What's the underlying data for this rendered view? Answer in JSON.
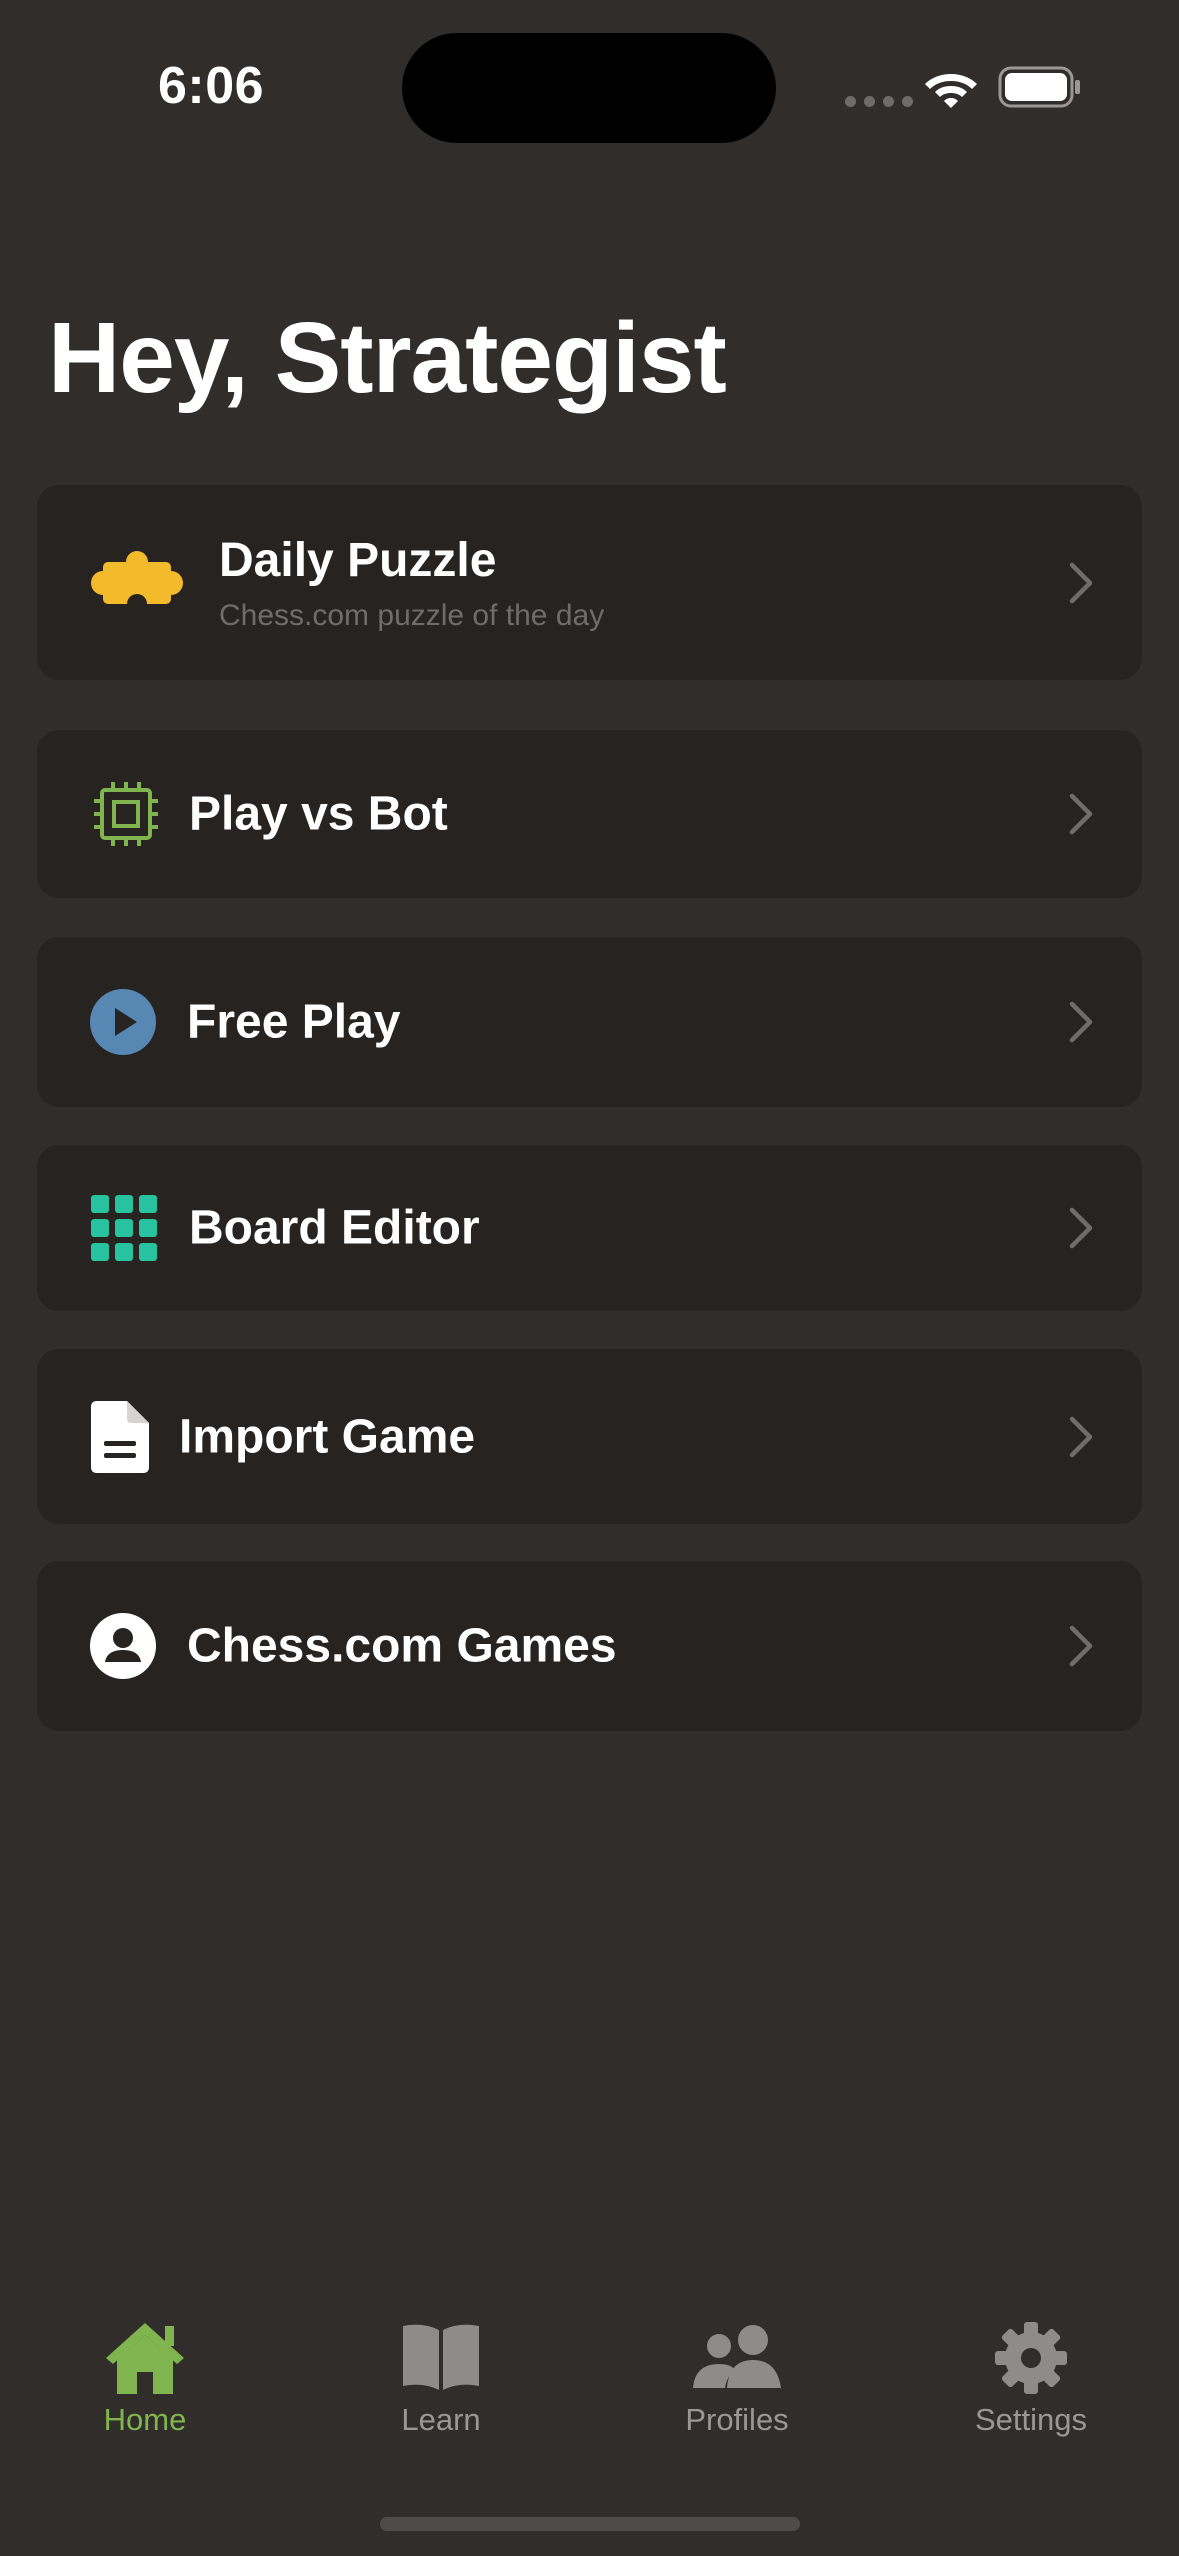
{
  "status_bar": {
    "time": "6:06"
  },
  "header": {
    "title": "Hey, Strategist"
  },
  "menu": [
    {
      "label": "Daily Puzzle",
      "subtitle": "Chess.com puzzle of the day",
      "icon": "puzzle-piece-icon",
      "icon_color": "#f3bb2c"
    },
    {
      "label": "Play vs Bot",
      "icon": "cpu-chip-icon",
      "icon_color": "#7fb44e"
    },
    {
      "label": "Free Play",
      "icon": "play-circle-icon",
      "icon_color": "#5787b3"
    },
    {
      "label": "Board Editor",
      "icon": "grid-icon",
      "icon_color": "#27c2a0"
    },
    {
      "label": "Import Game",
      "icon": "document-icon",
      "icon_color": "#ffffff"
    },
    {
      "label": "Chess.com Games",
      "icon": "person-circle-icon",
      "icon_color": "#ffffff"
    }
  ],
  "tab_bar": {
    "active": "Home",
    "active_color": "#7fb44e",
    "inactive_color": "#9a9795",
    "tabs": [
      {
        "label": "Home",
        "icon": "house-icon"
      },
      {
        "label": "Learn",
        "icon": "book-icon"
      },
      {
        "label": "Profiles",
        "icon": "people-icon"
      },
      {
        "label": "Settings",
        "icon": "gear-icon"
      }
    ]
  }
}
